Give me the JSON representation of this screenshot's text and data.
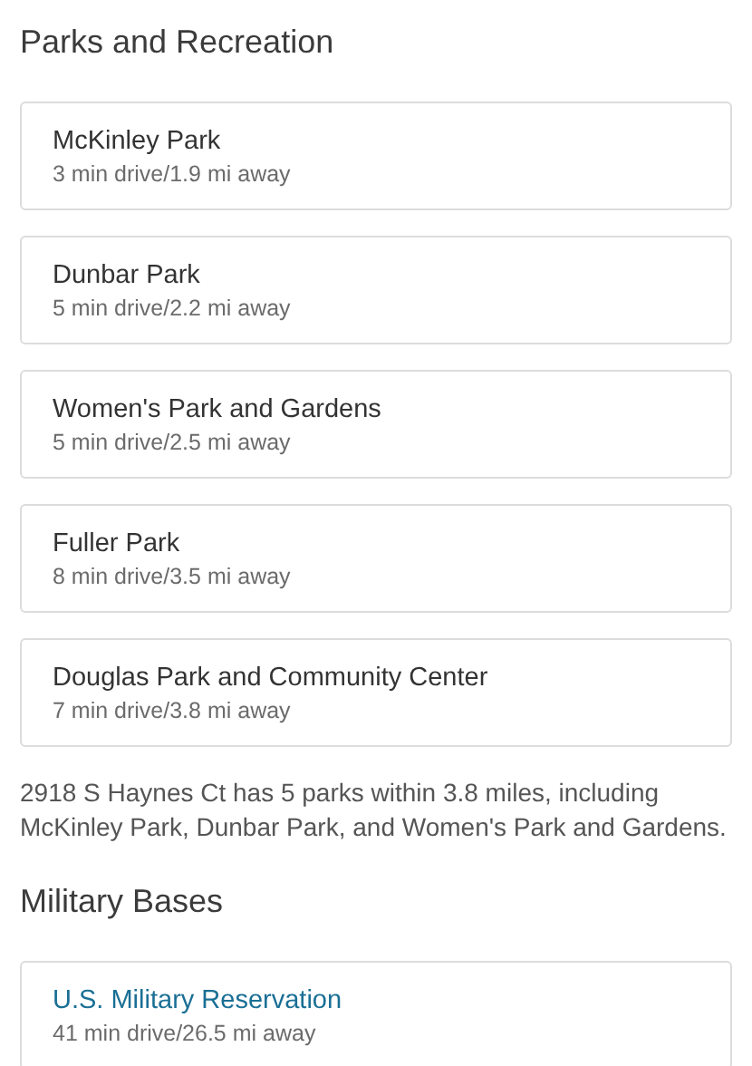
{
  "sections": [
    {
      "heading": "Parks and Recreation",
      "places": [
        {
          "name": "McKinley Park",
          "kind": "plain",
          "detail": "3 min drive/1.9 mi away"
        },
        {
          "name": "Dunbar Park",
          "kind": "plain",
          "detail": "5 min drive/2.2 mi away"
        },
        {
          "name": "Women's Park and Gardens",
          "kind": "plain",
          "detail": "5 min drive/2.5 mi away"
        },
        {
          "name": "Fuller Park",
          "kind": "plain",
          "detail": "8 min drive/3.5 mi away"
        },
        {
          "name": "Douglas Park and Community Center",
          "kind": "plain",
          "detail": "7 min drive/3.8 mi away"
        }
      ],
      "summary": "2918 S Haynes Ct has 5 parks within 3.8 miles, including McKinley Park, Dunbar Park, and Women's Park and Gardens."
    },
    {
      "heading": "Military Bases",
      "places": [
        {
          "name": "U.S. Military Reservation",
          "kind": "link",
          "detail": "41 min drive/26.5 mi away"
        }
      ]
    }
  ]
}
